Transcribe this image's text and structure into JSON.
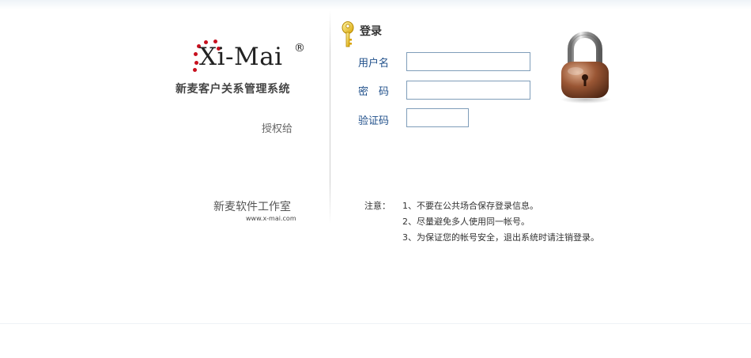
{
  "brand": {
    "logo_text": "Xi-Mai",
    "logo_mark": "®",
    "app_name": "新麦客户关系管理系统",
    "licensed_to_label": "授权给",
    "studio_name": "新麦软件工作室",
    "studio_url": "www.x-mai.com",
    "accent_color": "#c8101e"
  },
  "login": {
    "title": "登录",
    "key_icon": "key-icon",
    "lock_icon": "padlock-icon",
    "username_label": "用户名",
    "username_value": "",
    "password_label": "密　码",
    "password_value": "",
    "captcha_label": "验证码",
    "captcha_value": "",
    "label_color": "#1f4f8a"
  },
  "notice": {
    "label": "注意：",
    "items": [
      "1、不要在公共场合保存登录信息。",
      "2、尽量避免多人使用同一帐号。",
      "3、为保证您的帐号安全，退出系统时请注销登录。"
    ]
  }
}
